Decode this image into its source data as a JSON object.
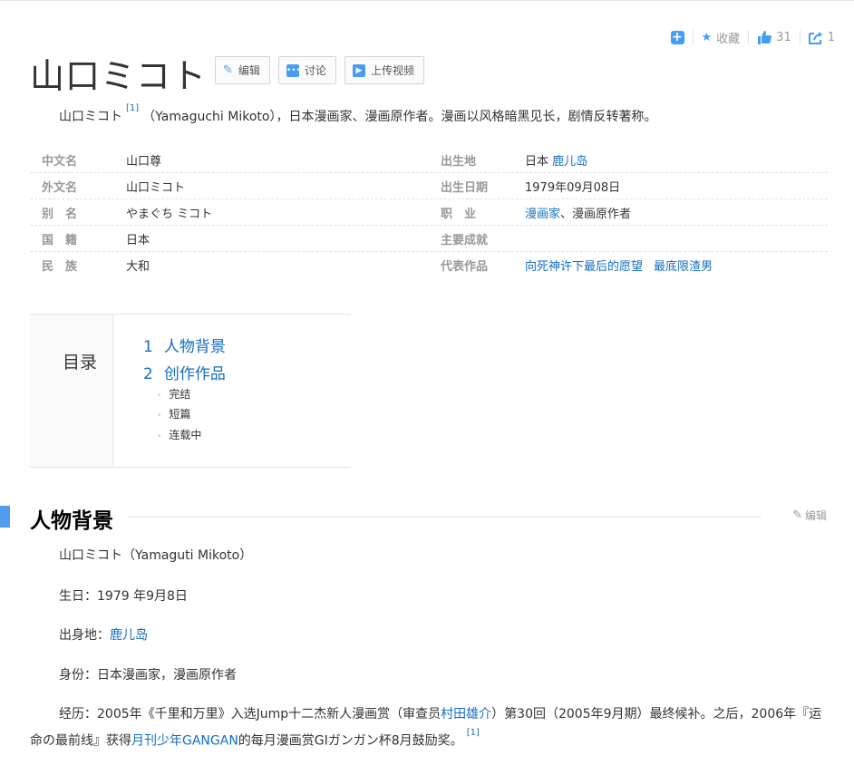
{
  "actions": {
    "collect_label": "收藏",
    "like_count": "31",
    "share_count": "1"
  },
  "title": "山口ミコト",
  "title_buttons": {
    "edit": "编辑",
    "discuss": "讨论",
    "upload_video": "上传视频"
  },
  "summary": {
    "name": "山口ミコト",
    "ref": "[1]",
    "text": "（Yamaguchi Mikoto），日本漫画家、漫画原作者。漫画以风格暗黑见长，剧情反转著称。"
  },
  "info": {
    "left": [
      {
        "key": "中文名",
        "value": "山口尊"
      },
      {
        "key": "外文名",
        "value": "山口ミコト"
      },
      {
        "key": "别　名",
        "value": "やまぐち ミコト"
      },
      {
        "key": "国　籍",
        "value": "日本"
      },
      {
        "key": "民　族",
        "value": "大和"
      }
    ],
    "birthplace": {
      "key": "出生地",
      "prefix": "日本",
      "link": "鹿儿岛"
    },
    "birthdate": {
      "key": "出生日期",
      "value": "1979年09月08日"
    },
    "occupation": {
      "key": "职　业",
      "link": "漫画家",
      "rest": "、漫画原作者"
    },
    "achievement": {
      "key": "主要成就",
      "value": ""
    },
    "works": {
      "key": "代表作品",
      "work1": "向死神许下最后的愿望",
      "work2": "最底限渣男"
    }
  },
  "catalog": {
    "title": "目录",
    "items": [
      {
        "num": "1",
        "label": "人物背景"
      },
      {
        "num": "2",
        "label": "创作作品"
      }
    ],
    "subitems": [
      "完结",
      "短篇",
      "连载中"
    ]
  },
  "section": {
    "title": "人物背景",
    "edit_label": "编辑"
  },
  "content": {
    "line1": "山口ミコト（Yamaguti Mikoto）",
    "line2": "生日：1979 年9月8日",
    "line3_prefix": "出身地：",
    "line3_link": "鹿儿岛",
    "line4": "身份：日本漫画家，漫画原作者",
    "p5_a": "经历：2005年《千里和万里》入选Jump十二杰新人漫画赏（审查员",
    "p5_link1": "村田雄介",
    "p5_b": "）第30回（2005年9月期）最终候补。之后，2006年『运命の最前线』获得",
    "p5_link2": "月刊少年GANGAN",
    "p5_c": "的每月漫画赏GIガンガン杯8月鼓励奖。",
    "p5_ref": "[1]"
  }
}
